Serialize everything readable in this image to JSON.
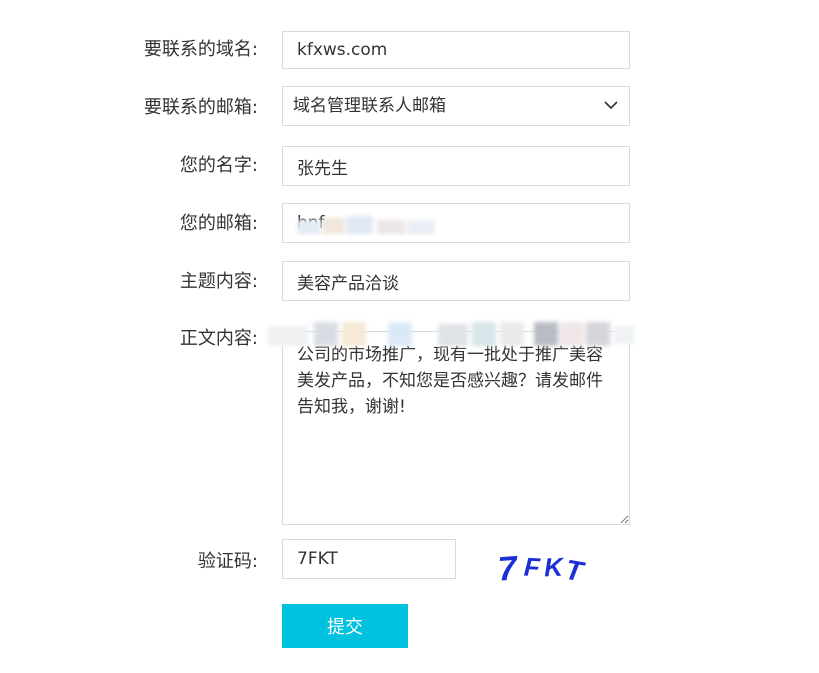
{
  "form": {
    "domain_label": "要联系的域名:",
    "domain_value": "kfxws.com",
    "contact_email_label": "要联系的邮箱:",
    "contact_email_selected": "域名管理联系人邮箱",
    "name_label": "您的名字:",
    "name_value": "张先生",
    "email_label": "您的邮箱:",
    "email_value_partial": "hnf",
    "subject_label": "主题内容:",
    "subject_value": "美容产品洽谈",
    "body_label": "正文内容:",
    "body_value": "公司的市场推广，现有一批处于推广美容美发产品，不知您是否感兴趣？请发邮件告知我，谢谢!",
    "captcha_label": "验证码:",
    "captcha_value": "7FKT",
    "captcha_image_text": "7FKT",
    "submit_label": "提交"
  },
  "colors": {
    "submit_bg": "#00c1de",
    "captcha_text": "#1a2fd6",
    "border": "#d9d9d9"
  },
  "icons": {
    "select_arrow": "chevron-down-icon"
  }
}
